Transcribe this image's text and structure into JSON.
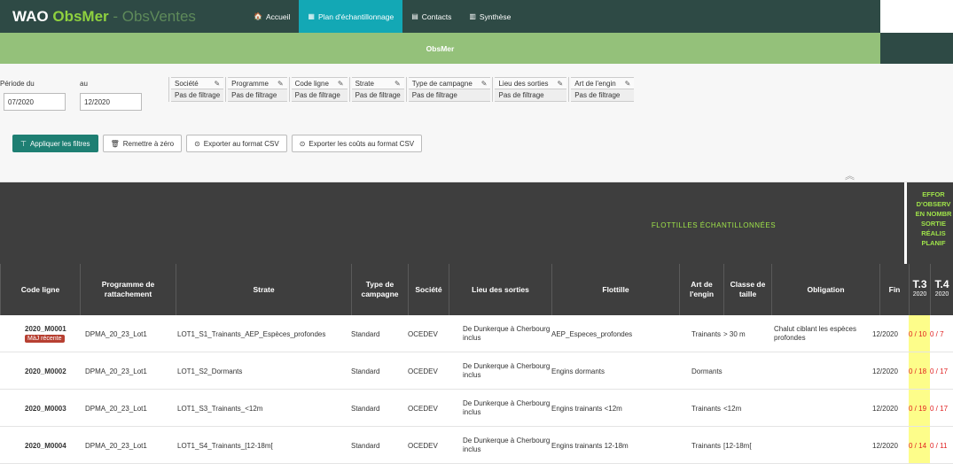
{
  "brand": {
    "part1": "WAO ",
    "part2": "ObsMer",
    "part3": " - ObsVentes"
  },
  "nav": [
    {
      "label": "Accueil",
      "icon": "home-icon",
      "glyph": "🏠"
    },
    {
      "label": "Plan d'échantillonnage",
      "icon": "calendar-icon",
      "glyph": "▦"
    },
    {
      "label": "Contacts",
      "icon": "contacts-icon",
      "glyph": "▤"
    },
    {
      "label": "Synthèse",
      "icon": "chart-icon",
      "glyph": "▥"
    }
  ],
  "subbar": {
    "title": "ObsMer"
  },
  "period": {
    "from_label": "Période du",
    "from_value": "07/2020",
    "to_label": "au",
    "to_value": "12/2020"
  },
  "filters": [
    {
      "label": "Société",
      "value": "Pas de filtrage"
    },
    {
      "label": "Programme",
      "value": "Pas de filtrage"
    },
    {
      "label": "Code ligne",
      "value": "Pas de filtrage"
    },
    {
      "label": "Strate",
      "value": "Pas de filtrage"
    },
    {
      "label": "Type de campagne",
      "value": "Pas de filtrage"
    },
    {
      "label": "Lieu des sorties",
      "value": "Pas de filtrage"
    },
    {
      "label": "Art de l'engin",
      "value": "Pas de filtrage"
    }
  ],
  "buttons": {
    "apply": "Appliquer les filtres",
    "reset": "Remettre à zéro",
    "export_csv": "Exporter au format CSV",
    "export_costs": "Exporter les coûts au format CSV"
  },
  "table": {
    "band_title": "FLOTTILLES ÉCHANTILLONNÉES",
    "effort_lines": [
      "EFFOR",
      "D'OBSERV",
      "EN NOMBR",
      "SORTIE",
      "RÉALIS",
      "PLANIF"
    ],
    "headers": {
      "code": "Code ligne",
      "programme": "Programme de rattachement",
      "strate": "Strate",
      "type": "Type de campagne",
      "societe": "Société",
      "lieu": "Lieu des sorties",
      "flottille": "Flottille",
      "art": "Art de l'engin",
      "classe": "Classe de taille",
      "obligation": "Obligation",
      "fin": "Fin",
      "t3": "T.3",
      "t3_year": "2020",
      "t4": "T.4",
      "t4_year": "2020"
    },
    "rows": [
      {
        "code": "2020_M0001",
        "badge": "MàJ récente",
        "programme": "DPMA_20_23_Lot1",
        "strate": "LOT1_S1_Trainants_AEP_Espèces_profondes",
        "type": "Standard",
        "societe": "OCEDEV",
        "lieu": "De Dunkerque à Cherbourg inclus",
        "flottille": "AEP_Especes_profondes",
        "art": "Trainants",
        "classe": "> 30 m",
        "obligation": "Chalut ciblant les espèces profondes",
        "fin": "12/2020",
        "t3": "0 / 10",
        "t4": "0 / 7"
      },
      {
        "code": "2020_M0002",
        "badge": "",
        "programme": "DPMA_20_23_Lot1",
        "strate": "LOT1_S2_Dormants",
        "type": "Standard",
        "societe": "OCEDEV",
        "lieu": "De Dunkerque à Cherbourg inclus",
        "flottille": "Engins dormants",
        "art": "Dormants",
        "classe": "",
        "obligation": "",
        "fin": "12/2020",
        "t3": "0 / 18",
        "t4": "0 / 17"
      },
      {
        "code": "2020_M0003",
        "badge": "",
        "programme": "DPMA_20_23_Lot1",
        "strate": "LOT1_S3_Trainants_<12m",
        "type": "Standard",
        "societe": "OCEDEV",
        "lieu": "De Dunkerque à Cherbourg inclus",
        "flottille": "Engins trainants <12m",
        "art": "Trainants",
        "classe": "<12m",
        "obligation": "",
        "fin": "12/2020",
        "t3": "0 / 19",
        "t4": "0 / 17"
      },
      {
        "code": "2020_M0004",
        "badge": "",
        "programme": "DPMA_20_23_Lot1",
        "strate": "LOT1_S4_Trainants_[12-18m[",
        "type": "Standard",
        "societe": "OCEDEV",
        "lieu": "De Dunkerque à Cherbourg inclus",
        "flottille": "Engins trainants 12-18m",
        "art": "Trainants",
        "classe": "[12-18m[",
        "obligation": "",
        "fin": "12/2020",
        "t3": "0 / 14",
        "t4": "0 / 11"
      }
    ]
  }
}
